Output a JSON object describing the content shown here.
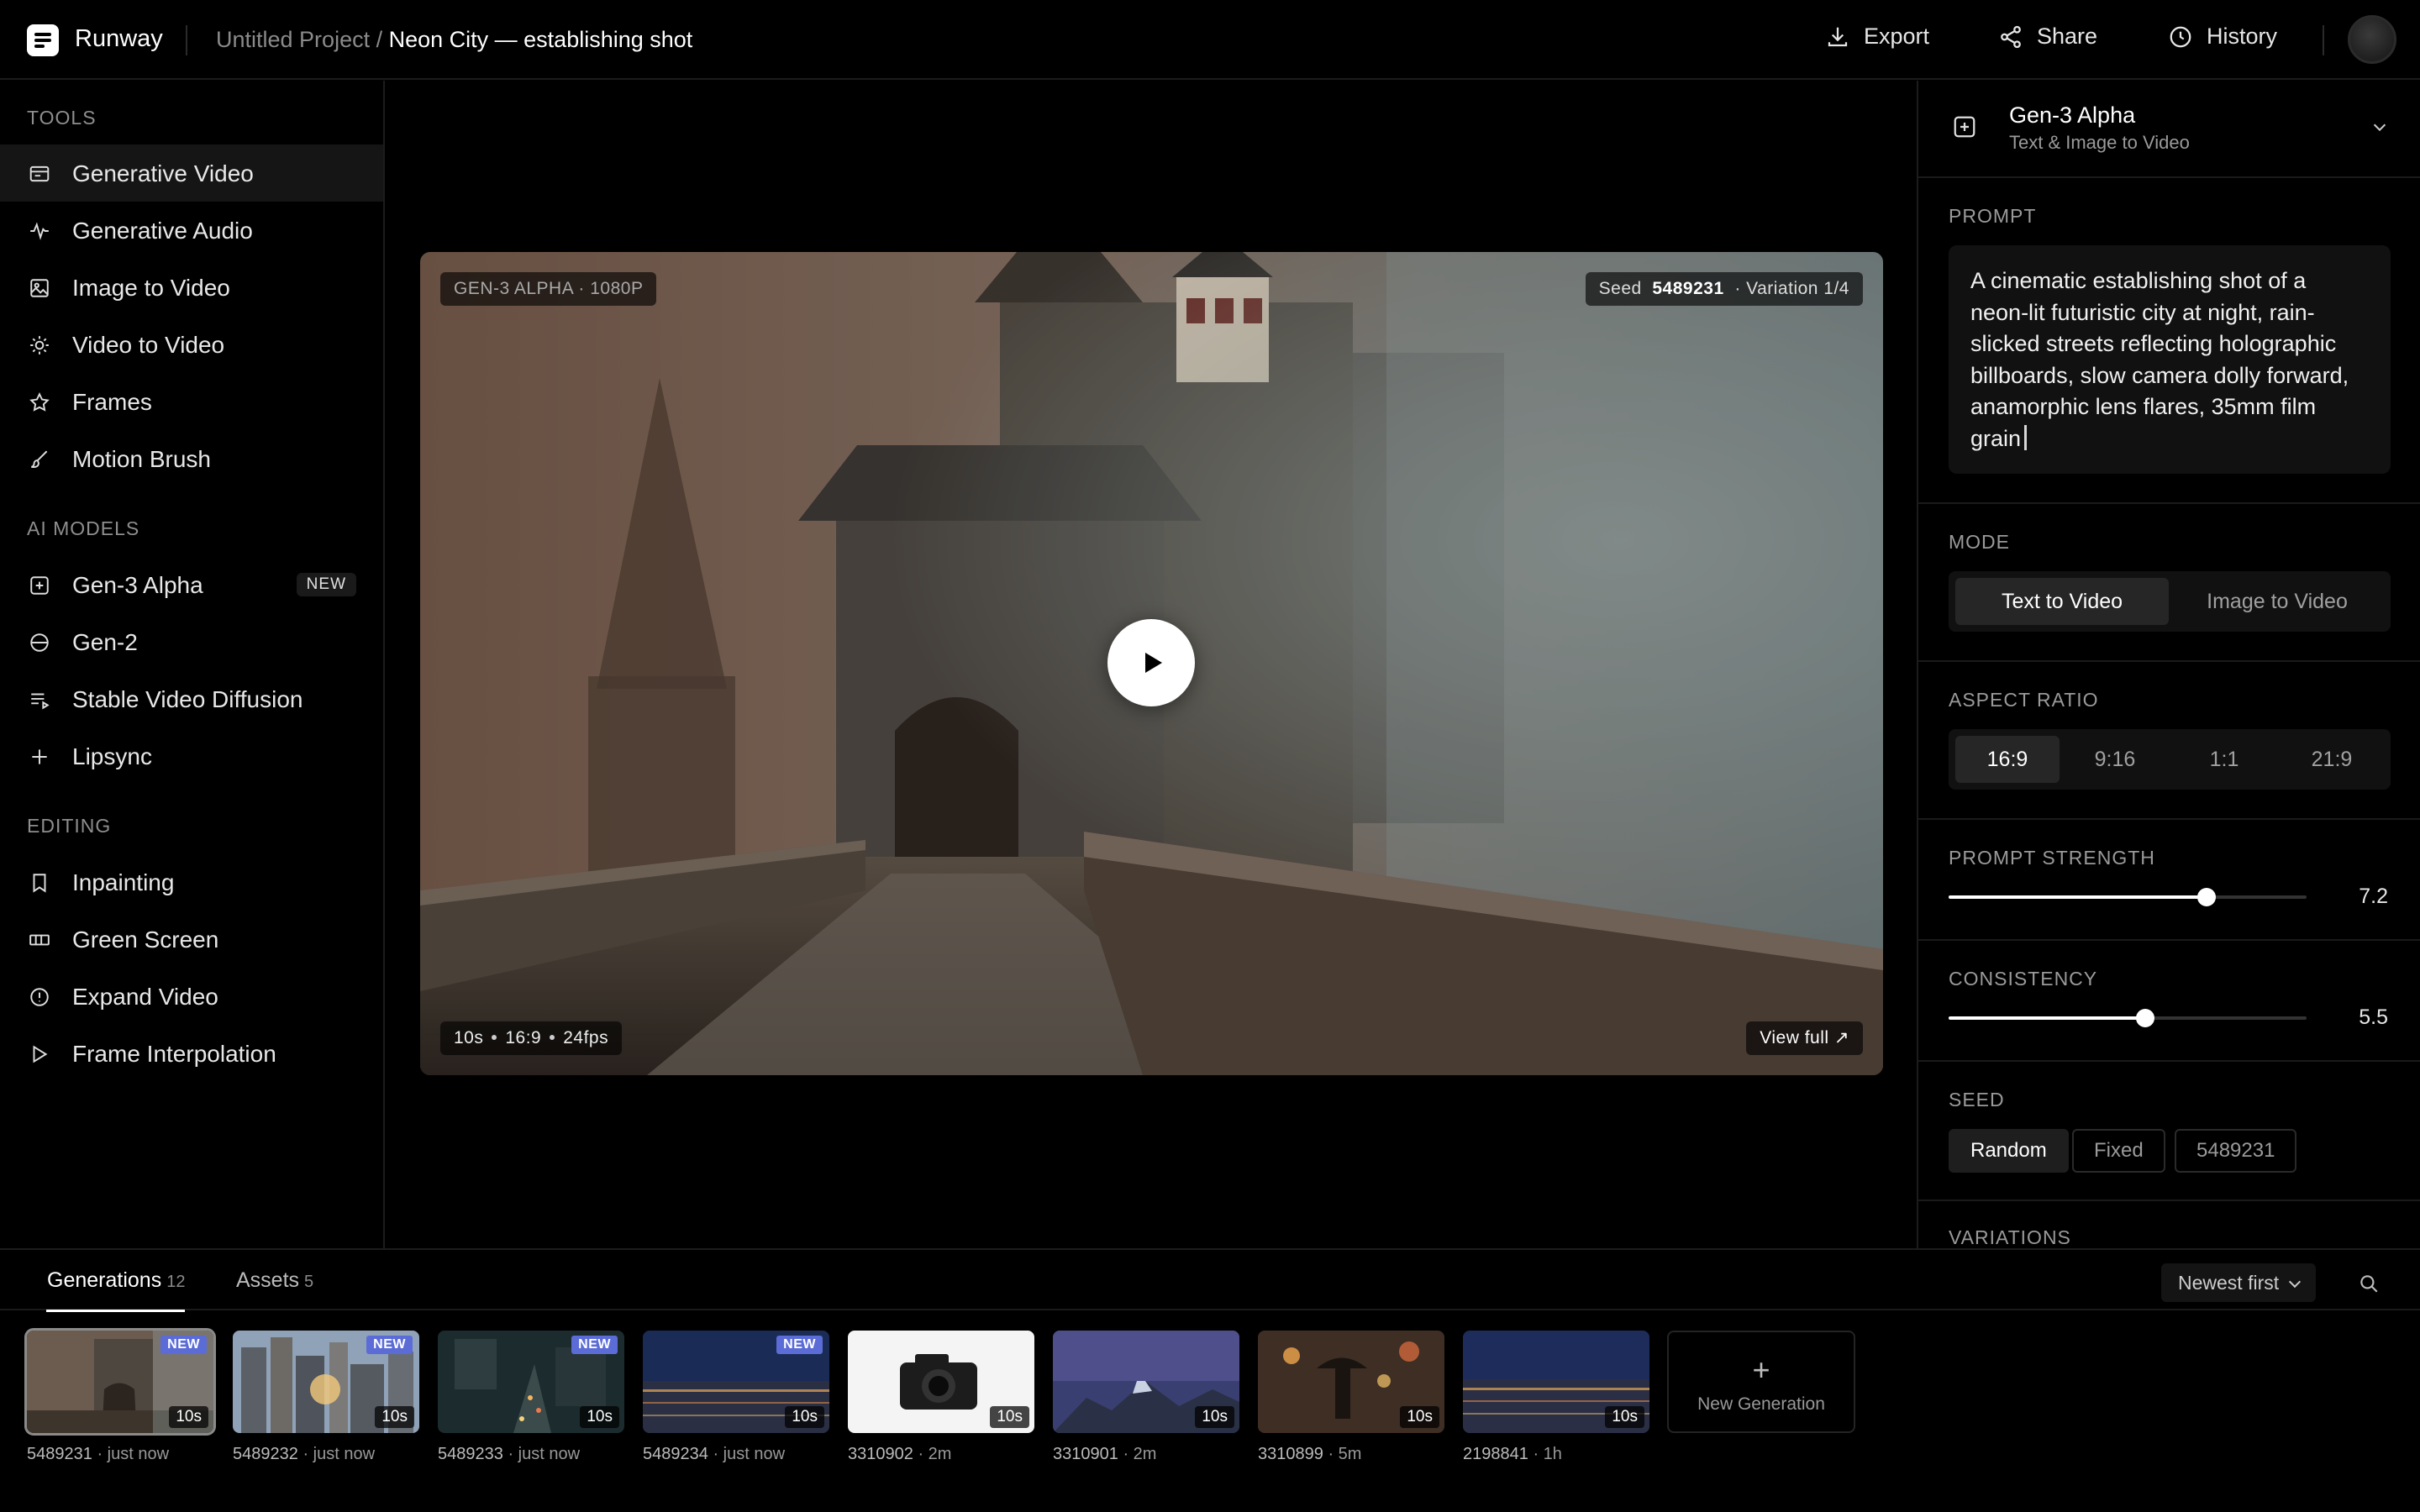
{
  "app": {
    "brand": "Runway",
    "project": "Untitled Project /",
    "scene": "Neon City — establishing shot"
  },
  "topbar": {
    "export_label": "Export",
    "share_label": "Share",
    "history_label": "History"
  },
  "sidebar": {
    "tools_title": "TOOLS",
    "tools": [
      {
        "label": "Generative Video",
        "icon": "film-icon",
        "active": true
      },
      {
        "label": "Generative Audio",
        "icon": "waveform-icon"
      },
      {
        "label": "Image to Video",
        "icon": "image-icon"
      },
      {
        "label": "Video to Video",
        "icon": "sun-icon"
      },
      {
        "label": "Frames",
        "icon": "star-icon"
      },
      {
        "label": "Motion Brush",
        "icon": "brush-icon"
      }
    ],
    "models_title": "AI MODELS",
    "models": [
      {
        "label": "Gen-3 Alpha",
        "icon": "plus-square-icon",
        "badge": "NEW"
      },
      {
        "label": "Gen-2",
        "icon": "circle-minus-icon"
      },
      {
        "label": "Stable Video Diffusion",
        "icon": "list-icon"
      },
      {
        "label": "Lipsync",
        "icon": "plus-icon"
      }
    ],
    "editing_title": "EDITING",
    "editing": [
      {
        "label": "Inpainting",
        "icon": "bookmark-icon"
      },
      {
        "label": "Green Screen",
        "icon": "layers-icon"
      },
      {
        "label": "Expand Video",
        "icon": "info-circle-icon"
      },
      {
        "label": "Frame Interpolation",
        "icon": "play-outline-icon"
      }
    ]
  },
  "player": {
    "model_chip": "GEN-3 ALPHA · 1080P",
    "seed_label": "Seed",
    "seed_value": "5489231",
    "variation": "· Variation 1/4",
    "meta_duration": "10s",
    "meta_ratio": "16:9",
    "meta_fps": "24fps",
    "view_full": "View full ↗"
  },
  "panel": {
    "model_name": "Gen-3 Alpha",
    "model_sub": "Text & Image to Video",
    "prompt_title": "PROMPT",
    "prompt_text": "A cinematic establishing shot of a neon-lit futuristic city at night, rain-slicked streets reflecting holographic billboards, slow camera dolly forward, anamorphic lens flares, 35mm film grain",
    "mode_title": "MODE",
    "modes": [
      "Text to Video",
      "Image to Video"
    ],
    "aspect_title": "ASPECT RATIO",
    "aspects": [
      "16:9",
      "9:16",
      "1:1",
      "21:9"
    ],
    "strength_title": "PROMPT STRENGTH",
    "strength_value": "7.2",
    "strength_level": 0.72,
    "consistency_title": "CONSISTENCY",
    "consistency_value": "5.5",
    "consistency_level": 0.55,
    "seed_title": "SEED",
    "seed_options": [
      "Random",
      "Fixed",
      "5489231"
    ],
    "variations_title": "VARIATIONS"
  },
  "bottom": {
    "tab_generations": "Generations",
    "generations_count": "12",
    "tab_assets": "Assets",
    "assets_count": "5",
    "sort_label": "Newest first",
    "new_generation_label": "New Generation",
    "items": [
      {
        "id": "5489231",
        "age": "· just now",
        "duration": "10s",
        "badge": "NEW"
      },
      {
        "id": "5489232",
        "age": "· just now",
        "duration": "10s",
        "badge": "NEW"
      },
      {
        "id": "5489233",
        "age": "· just now",
        "duration": "10s",
        "badge": "NEW"
      },
      {
        "id": "5489234",
        "age": "· just now",
        "duration": "10s",
        "badge": "NEW"
      },
      {
        "id": "3310902",
        "age": "· 2m",
        "duration": "10s"
      },
      {
        "id": "3310901",
        "age": "· 2m",
        "duration": "10s"
      },
      {
        "id": "3310899",
        "age": "· 5m",
        "duration": "10s"
      },
      {
        "id": "2198841",
        "age": "· 1h",
        "duration": "10s"
      }
    ]
  }
}
